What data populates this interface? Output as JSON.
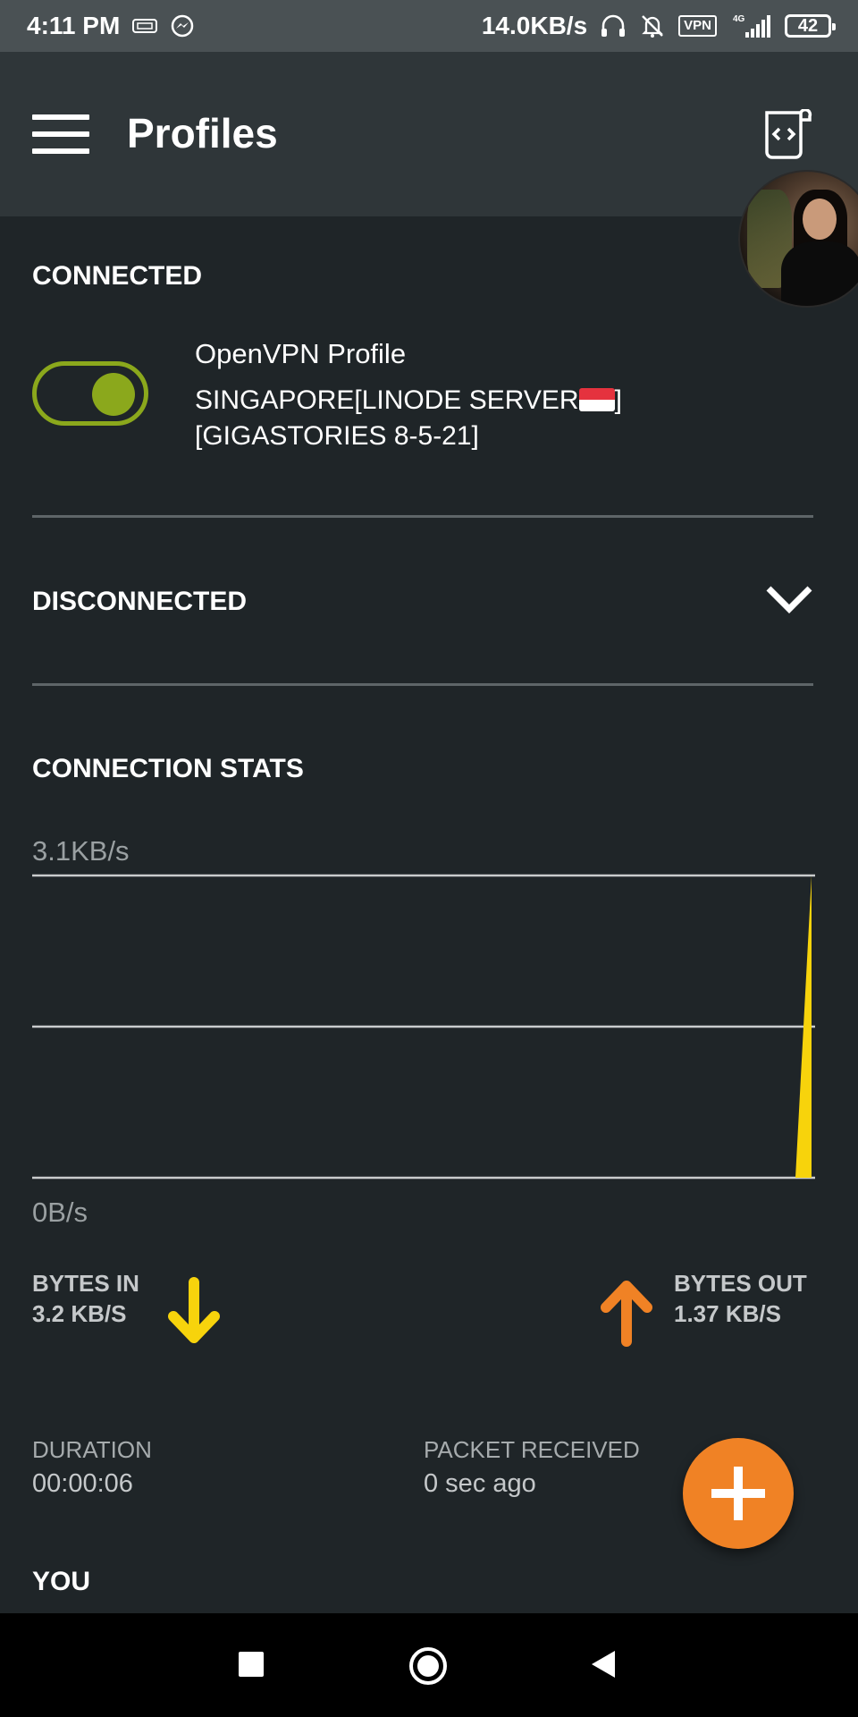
{
  "status_bar": {
    "time": "4:11 PM",
    "network_speed": "14.0KB/s",
    "vpn_label": "VPN",
    "signal_label": "4G",
    "battery": "42",
    "icons": [
      "sim-card-icon",
      "messenger-icon",
      "headset-icon",
      "notifications-off-icon",
      "vpn-icon",
      "signal-icon",
      "battery-icon"
    ]
  },
  "app_bar": {
    "title": "Profiles",
    "icons": [
      "menu-icon",
      "log-scroll-icon"
    ]
  },
  "connected": {
    "header": "CONNECTED",
    "profile_name": "OpenVPN Profile",
    "server_line1": "SINGAPORE[LINODE SERVER",
    "server_line1_end": "]",
    "server_line2": "[GIGASTORIES 8-5-21]",
    "toggle_on": true
  },
  "disconnected": {
    "header": "DISCONNECTED",
    "icon": "chevron-down-icon"
  },
  "stats": {
    "header": "CONNECTION STATS",
    "bytes_in_label": "BYTES IN",
    "bytes_in_value": "3.2 KB/S",
    "bytes_out_label": "BYTES OUT",
    "bytes_out_value": "1.37 KB/S",
    "duration_label": "DURATION",
    "duration_value": "00:00:06",
    "packet_label": "PACKET RECEIVED",
    "packet_value": "0 sec ago"
  },
  "you": {
    "header": "YOU"
  },
  "colors": {
    "accent_green": "#8ba81c",
    "in_yellow": "#f7d30c",
    "out_orange": "#f08225",
    "background": "#1f2528"
  },
  "chart_data": {
    "type": "area",
    "title": "",
    "xlabel": "",
    "ylabel": "",
    "y_top_label": "3.1KB/s",
    "y_bottom_label": "0B/s",
    "ylim": [
      0,
      3.1
    ],
    "y_unit": "KB/s",
    "x": [
      0,
      1,
      2,
      3,
      4,
      5,
      6,
      7,
      8,
      9,
      10,
      11,
      12
    ],
    "series": [
      {
        "values": [
          0,
          0,
          0,
          0,
          0,
          0,
          0,
          0,
          0,
          0,
          0,
          0,
          3.1
        ]
      }
    ]
  }
}
